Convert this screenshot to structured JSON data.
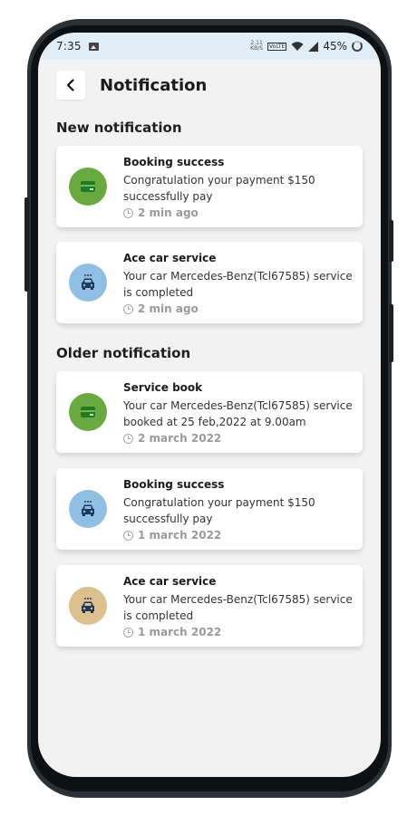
{
  "status_bar": {
    "time": "7:35",
    "speed_value": "2.11",
    "speed_unit": "KB/S",
    "volte": "VoLTE",
    "battery": "45%"
  },
  "header": {
    "title": "Notification",
    "back_icon": "chevron-left-icon"
  },
  "sections": [
    {
      "title": "New notification",
      "items": [
        {
          "title": "Booking success",
          "message": "Congratulation your payment $150 successfully pay",
          "time": "2 min ago",
          "icon": "wallet-icon",
          "icon_bg": "#6aa93f"
        },
        {
          "title": "Ace car service",
          "message": "Your car Mercedes-Benz(Tcl67585) service is completed",
          "time": "2 min ago",
          "icon": "car-service-icon",
          "icon_bg": "#8fc0e3"
        }
      ]
    },
    {
      "title": "Older notification",
      "items": [
        {
          "title": "Service book",
          "message": "Your car Mercedes-Benz(Tcl67585) service booked at 25 feb,2022 at 9.00am",
          "time": "2 march 2022",
          "icon": "wallet-icon",
          "icon_bg": "#6aa93f"
        },
        {
          "title": "Booking success",
          "message": "Congratulation your payment $150 successfully pay",
          "time": "1 march 2022",
          "icon": "car-service-icon",
          "icon_bg": "#8fc0e3"
        },
        {
          "title": "Ace car service",
          "message": "Your car Mercedes-Benz(Tcl67585) service is completed",
          "time": "1 march 2022",
          "icon": "car-service-icon",
          "icon_bg": "#dcc08c"
        }
      ]
    }
  ]
}
